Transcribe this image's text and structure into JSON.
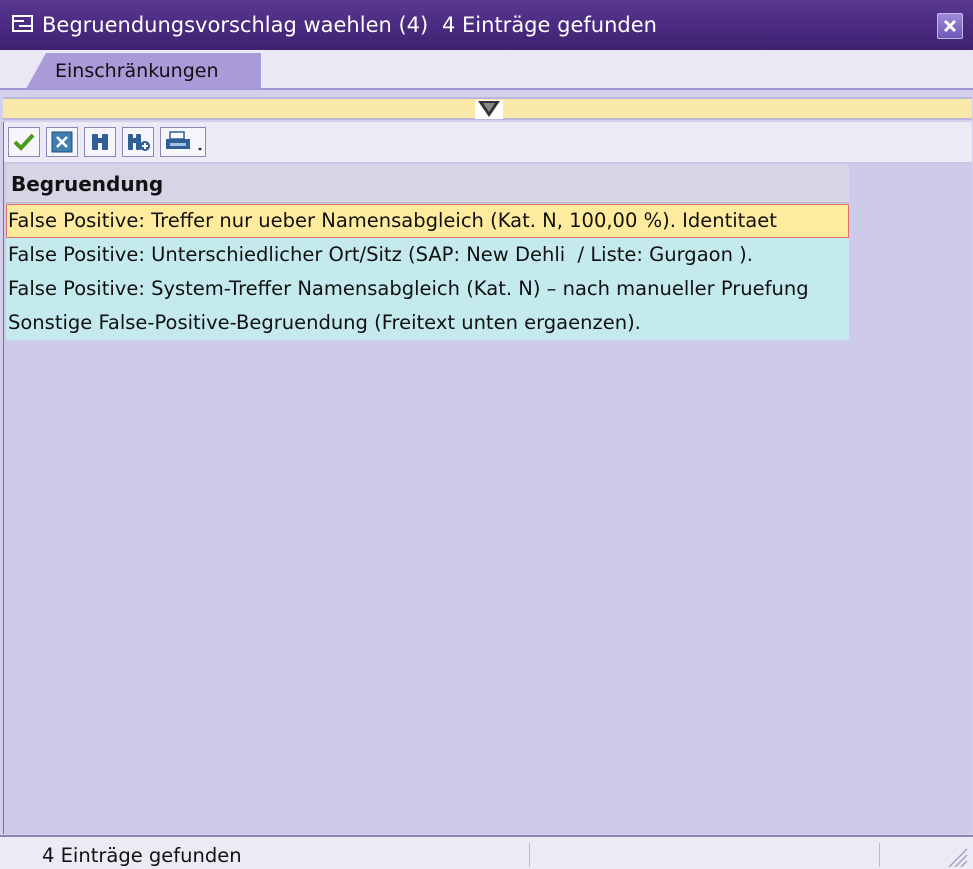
{
  "window": {
    "title": "Begruendungsvorschlag waehlen (4)",
    "info": "4 Einträge gefunden",
    "close_icon": "close-icon"
  },
  "tabs": [
    {
      "label": "Einschränkungen"
    }
  ],
  "toolbar": {
    "buttons": [
      "checkmark-icon",
      "cancel-icon",
      "find-icon",
      "find-next-icon",
      "print-icon"
    ]
  },
  "table": {
    "column_header": "Begruendung",
    "rows": [
      "False Positive: Treffer nur ueber Namensabgleich (Kat. N, 100,00 %). Identitaet",
      "False Positive: Unterschiedlicher Ort/Sitz (SAP: New Dehli  / Liste: Gurgaon ).",
      "False Positive: System-Treffer Namensabgleich (Kat. N) – nach manueller Pruefung",
      "Sonstige False-Positive-Begruendung (Freitext unten ergaenzen)."
    ],
    "selected_index": 0
  },
  "status": {
    "text": "4 Einträge gefunden"
  },
  "colors": {
    "title_bar": "#4a2a80",
    "selected_row": "#ffeb9e",
    "row_background": "#c4eaee",
    "content_background": "#cdcbe9"
  }
}
